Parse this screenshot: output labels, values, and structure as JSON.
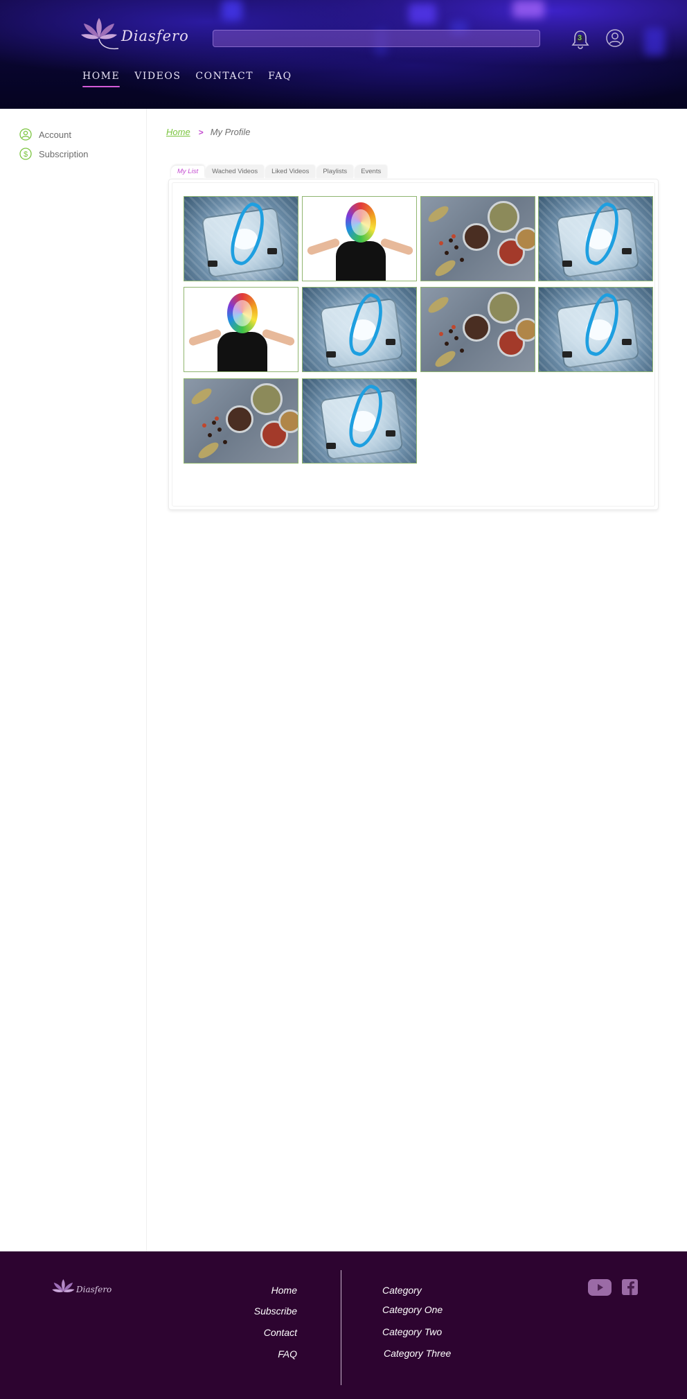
{
  "brand": {
    "name": "Diasfero"
  },
  "header": {
    "search": {
      "placeholder": ""
    },
    "notifications": {
      "count": "3"
    },
    "nav": [
      {
        "label": "HOME",
        "active": true
      },
      {
        "label": "VIDEOS",
        "active": false
      },
      {
        "label": "CONTACT",
        "active": false
      },
      {
        "label": "FAQ",
        "active": false
      }
    ]
  },
  "sidebar": {
    "items": [
      {
        "label": "Account",
        "icon": "user-circle-icon"
      },
      {
        "label": "Subscription",
        "icon": "dollar-circle-icon"
      }
    ]
  },
  "breadcrumb": {
    "home": "Home",
    "separator": ">",
    "current": "My Profile"
  },
  "tabs": [
    {
      "label": "My List",
      "active": true
    },
    {
      "label": "Wached Videos",
      "active": false
    },
    {
      "label": "Liked Videos",
      "active": false
    },
    {
      "label": "Playlists",
      "active": false
    },
    {
      "label": "Events",
      "active": false
    }
  ],
  "my_list": {
    "items": [
      {
        "image": "scale-with-measuring-tape"
      },
      {
        "image": "person-shrugging-protein-head"
      },
      {
        "image": "spices-in-jars"
      },
      {
        "image": "scale-with-measuring-tape"
      },
      {
        "image": "person-shrugging-protein-head"
      },
      {
        "image": "scale-with-measuring-tape"
      },
      {
        "image": "spices-in-jars"
      },
      {
        "image": "scale-with-measuring-tape"
      },
      {
        "image": "spices-in-jars"
      },
      {
        "image": "scale-with-measuring-tape"
      }
    ]
  },
  "footer": {
    "links": [
      "Home",
      "Subscribe",
      "Contact",
      "FAQ"
    ],
    "categories_heading": "Category",
    "categories": [
      "Category One",
      "Category Two",
      "Category Three"
    ],
    "social": [
      {
        "icon": "youtube-icon"
      },
      {
        "icon": "facebook-icon"
      }
    ]
  },
  "colors": {
    "accent_pink": "#c34bd0",
    "accent_green": "#7ac43e",
    "footer_bg": "#2d0430",
    "header_bg": "#07052a"
  }
}
